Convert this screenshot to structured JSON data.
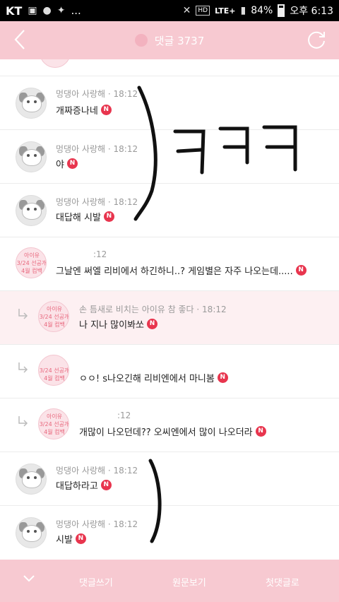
{
  "status_bar": {
    "carrier": "KT",
    "notification_icons": [
      "image-icon",
      "talk-icon",
      "twitter-icon"
    ],
    "more": "...",
    "hd": "HD",
    "network": "LTE+",
    "battery": "84%",
    "time": "오후 6:13"
  },
  "header": {
    "title": "댓글 3737"
  },
  "comments": [
    {
      "nick": "멍댕아 사랑해",
      "time": "· 18:12",
      "text": "개짜증나네",
      "badge": "N"
    },
    {
      "nick": "멍댕아 사랑해",
      "time": "· 18:12",
      "text": "야",
      "badge": "N"
    },
    {
      "nick": "멍댕아 사랑해",
      "time": "· 18:12",
      "text": "대답해 시발",
      "badge": "N"
    },
    {
      "nick": "",
      "time": ":12",
      "text": "그날엔 써엘 리비에서 하긴하니..? 게임별은 자주 나오는데.....",
      "badge": "N",
      "avatar_badge": [
        "아이유",
        "3/24 선공개",
        "4월 컴백"
      ]
    },
    {
      "nick": "손 틈새로 비치는 아이유 참 좋다",
      "time": "· 18:12",
      "text": "나 지나 많이봐쏘",
      "badge": "N",
      "avatar_badge": [
        "아이유",
        "3/24 선공개",
        "4월 컴백"
      ]
    },
    {
      "nick": "",
      "time": "",
      "text": "ㅇㅇ! s나오긴해 리비엔에서 마니봄",
      "badge": "N",
      "avatar_badge": [
        "",
        "3/24 선공개",
        "4월 컴백"
      ]
    },
    {
      "nick": "",
      "time": ":12",
      "text": "개많이 나오던데?? 오씨엔에서 많이 나오더라",
      "badge": "N",
      "avatar_badge": [
        "아이유",
        "3/24 선공개",
        "4월 컴백"
      ]
    },
    {
      "nick": "멍댕아 사랑해",
      "time": "· 18:12",
      "text": "대답하라고",
      "badge": "N"
    },
    {
      "nick": "멍댕아 사랑해",
      "time": "· 18:12",
      "text": "시발",
      "badge": "N"
    }
  ],
  "bottom_bar": {
    "write": "댓글쓰기",
    "view_original": "원문보기",
    "first_comment": "첫댓글로"
  },
  "annotation": {
    "drawn_text": "ㅋㅋㅋ"
  },
  "colors": {
    "header": "#f7c9d1",
    "badge": "#e8354e"
  }
}
